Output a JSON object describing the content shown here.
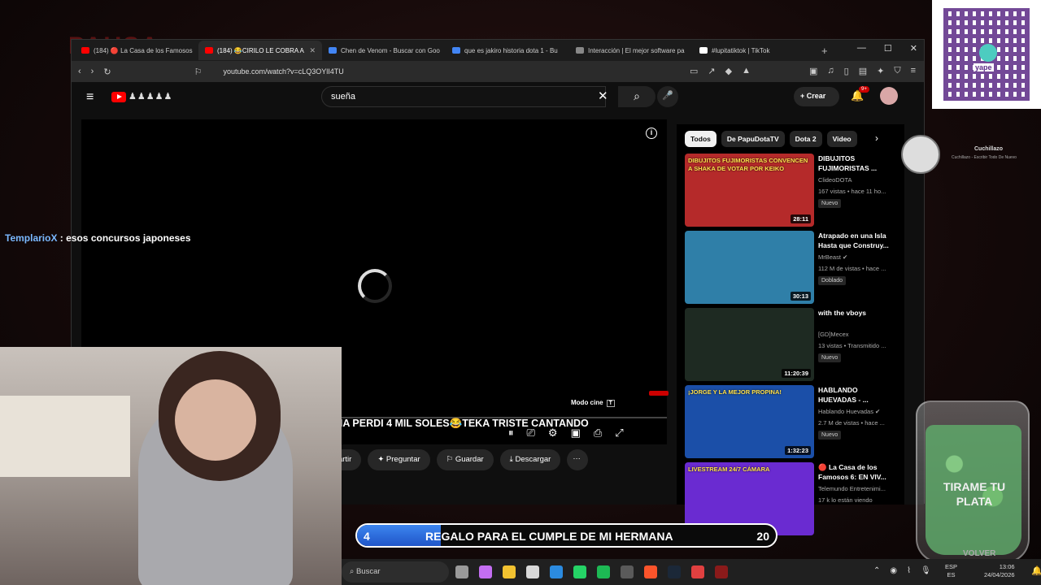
{
  "overlay": {
    "pausa": "PAUSA",
    "chat": {
      "user": "TemplarioX",
      "message": " : esos concursos japoneses"
    },
    "cuchillazo": {
      "name": "Cuchillazo",
      "subtitle": "Cuchillazo - Escribir Todo De Nuevo"
    },
    "yape_label": "yape",
    "jar_text": "TIRAME TU PLATA",
    "volver": "VOLVER",
    "goal": {
      "current": "4",
      "title": "REGALO PARA EL CUMPLE DE MI HERMANA",
      "target": "20",
      "progress_fraction": 0.2
    }
  },
  "browser": {
    "tabs": [
      {
        "label": "(184) 🔴 La Casa de los Famosos",
        "active": false,
        "color": "#ff0000"
      },
      {
        "label": "(184) 😂CIRILO LE COBRA A",
        "active": true,
        "color": "#ff0000"
      },
      {
        "label": "Chen de Venom - Buscar con Goo",
        "active": false,
        "color": "#4285f4"
      },
      {
        "label": "que es jakiro historia dota 1 - Bu",
        "active": false,
        "color": "#4285f4"
      },
      {
        "label": "Interacción | El mejor software pa",
        "active": false,
        "color": "#888888"
      },
      {
        "label": "#lupitatiktok | TikTok",
        "active": false,
        "color": "#ffffff"
      }
    ],
    "new_tab": "+",
    "url": "youtube.com/watch?v=cLQ3OYlI4TU"
  },
  "youtube": {
    "search_value": "sueña",
    "create_label": "Crear",
    "notif_count": "9+",
    "video": {
      "modo_cine": "Modo cine",
      "modo_cine_key": "T",
      "title": "JE A COLOMBIA PERDI 4 MIL SOLES😂TEKA TRISTE CANTANDO"
    },
    "actions": [
      "Compartir",
      "Preguntar",
      "Guardar",
      "Descargar"
    ],
    "chips": [
      "Todos",
      "De PapuDotaTV",
      "Dota 2",
      "Video"
    ],
    "recommendations": [
      {
        "title": "DIBUJITOS FUJIMORISTAS ...",
        "channel": "ClideoDOTA",
        "stats": "167 vistas • hace 11 ho...",
        "badge": "Nuevo",
        "duration": "28:11",
        "thumb": "#b52a2a",
        "thumb_text": "DIBUJITOS FUJIMORISTAS CONVENCEN A SHAKA DE VOTAR POR KEIKO"
      },
      {
        "title": "Atrapado en una Isla Hasta que Construy...",
        "channel": "MrBeast ✔",
        "stats": "112 M de vistas • hace ...",
        "badge": "Doblado",
        "duration": "30:13",
        "thumb": "#2f7fa8",
        "thumb_text": ""
      },
      {
        "title": "with the vboys",
        "channel": "[GD]Mecex",
        "stats": "13 vistas • Transmitido ...",
        "badge": "Nuevo",
        "duration": "11:20:39",
        "thumb": "#1e2a22",
        "thumb_text": ""
      },
      {
        "title": "HABLANDO HUEVADAS - ...",
        "channel": "Hablando Huevadas ✔",
        "stats": "2.7 M de vistas • hace ...",
        "badge": "Nuevo",
        "duration": "1:32:23",
        "thumb": "#1b4fa8",
        "thumb_text": "¡JORGE Y LA MEJOR PROPINA!"
      },
      {
        "title": "🔴 La Casa de los Famosos 6: EN VIV...",
        "channel": "Telemundo Entretenimi...",
        "stats": "17 k lo están viendo",
        "badge": "",
        "duration": "",
        "thumb": "#6a2bd1",
        "thumb_text": "LIVESTREAM 24/7 CÁMARA"
      }
    ]
  },
  "taskbar": {
    "search": "Buscar",
    "lang1": "ESP",
    "lang2": "ES",
    "time": "13:06",
    "date": "24/04/2026",
    "apps": [
      "#9a9a9a",
      "#c46ef2",
      "#f2c230",
      "#d9d9d9",
      "#2b8be0",
      "#25d366",
      "#1db954",
      "#5a5a5a",
      "#fb542b",
      "#1b2838",
      "#e04040",
      "#8a1a1a"
    ]
  }
}
